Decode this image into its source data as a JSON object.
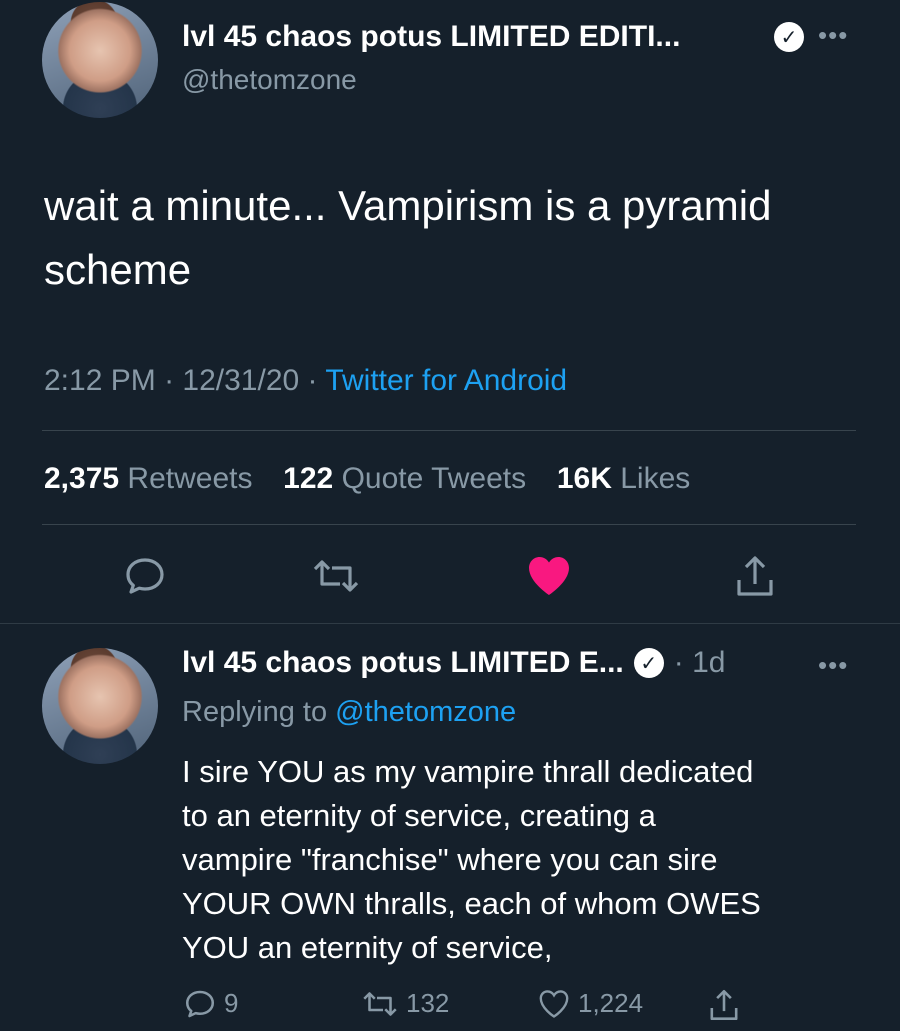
{
  "main_tweet": {
    "display_name": "lvl 45 chaos potus LIMITED EDITI...",
    "handle": "@thetomzone",
    "text": "wait a minute... Vampirism is a pyramid scheme",
    "time": "2:12 PM",
    "date": "12/31/20",
    "source": "Twitter for Android",
    "retweets_count": "2,375",
    "retweets_label": "Retweets",
    "quotes_count": "122",
    "quotes_label": "Quote Tweets",
    "likes_count": "16K",
    "likes_label": "Likes",
    "liked": true,
    "colors": {
      "like_active": "#f91880",
      "link": "#1da1f2"
    }
  },
  "reply_tweet": {
    "display_name": "lvl 45 chaos potus LIMITED E...",
    "age": "1d",
    "replying_prefix": "Replying to",
    "replying_handle": "@thetomzone",
    "text_lines": [
      "I sire YOU as my vampire thrall dedicated",
      "to an eternity of service, creating a",
      "vampire \"franchise\" where you can sire",
      "YOUR OWN thralls, each of whom OWES",
      "YOU an eternity of service,"
    ],
    "reply_count": "9",
    "retweet_count": "132",
    "like_count": "1,224"
  },
  "icons": [
    "verified-badge-icon",
    "more-icon",
    "reply-icon",
    "retweet-icon",
    "like-icon",
    "share-icon"
  ]
}
